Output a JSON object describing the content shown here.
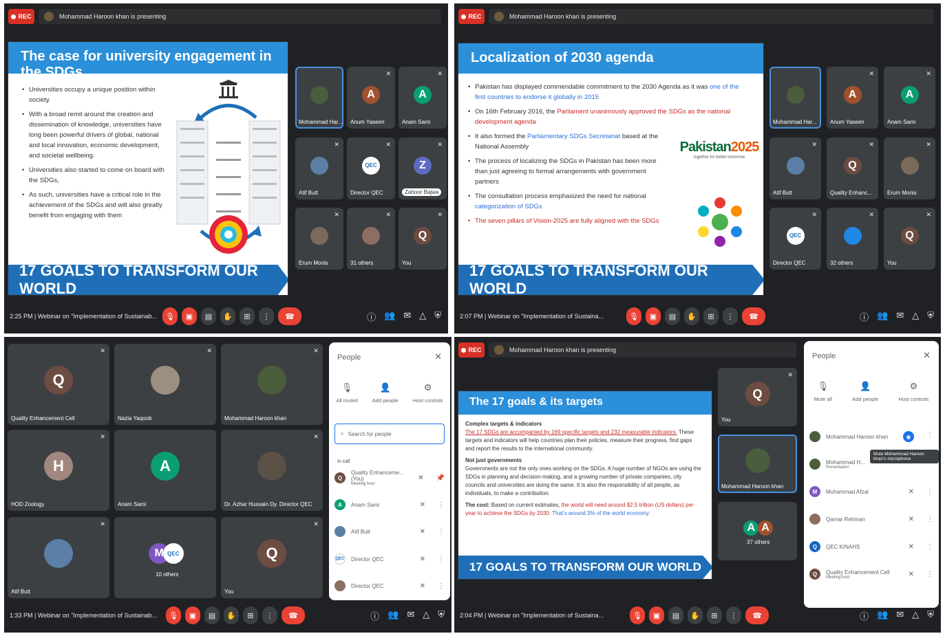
{
  "colors": {
    "meet_bg": "#202124",
    "tile": "#3c4043",
    "accent": "#4a90e2",
    "red": "#ea4335",
    "slide_blue": "#2b8fd9"
  },
  "q1": {
    "rec": "REC",
    "presenting": "Mohammad Haroon khan is presenting",
    "slide_title": "The case for university engagement in the SDGs",
    "bullets": [
      "Universities occupy a unique position within society.",
      "With a broad remit around the creation and dissemination of knowledge, universities have long been powerful drivers of global, national and local innovation, economic development, and societal wellbeing.",
      "Universities also started to come on board with the SDGs,",
      "As such, universities have a critical role in the achievement of the SDGs and will also greatly benefit from engaging with them"
    ],
    "footer": "17 GOALS TO TRANSFORM OUR WORLD",
    "tiles": [
      "Mohammad Har...",
      "Anum Yaseen",
      "Anam Sami",
      "Atif Butt",
      "Director QEC",
      "Zahoor Bajwa",
      "Erum Monis",
      "31 others",
      "You"
    ],
    "time": "2:25 PM",
    "meeting": "Webinar on \"Implementation of Sustainab..."
  },
  "q2": {
    "rec": "REC",
    "presenting": "Mohammad Haroon khan is presenting",
    "slide_title": "Localization of 2030 agenda",
    "b1": "Pakistan has displayed commendable commitment to the 2030 Agenda as it was ",
    "b1h": "one of the first countries to endorse it globally in 2015",
    "b2": "On 16th February 2016, the ",
    "b2h": "Parliament unanimously approved the SDGs as the national development agenda",
    "b3": "It also formed the ",
    "b3h": "Parliamentary SDGs Secretariat",
    " b3e": "",
    "b3t": " based at the National Assembly",
    "b4": "The process of localizing the SDGs in Pakistan has been more than just agreeing to formal arrangements with government partners",
    "b5": "The consultation process emphasized the need for national ",
    "b5h": "categorization of SDGs",
    "b6": "The seven pillars of Vision-2025 are fully aligned with the SDGs",
    "logo": "Pakistan2025",
    "logo_tag": "together for better tomorrow",
    "footer": "17 GOALS TO TRANSFORM OUR WORLD",
    "tiles": [
      "Mohammad Har...",
      "Anum Yaseen",
      "Anam Sami",
      "Atif Butt",
      "Quality Enhanc...",
      "Erum Monis",
      "Director QEC",
      "32 others",
      "You"
    ],
    "time": "2:07 PM",
    "meeting": "Webinar on \"Implementation of Sustaina..."
  },
  "q3": {
    "tiles": [
      "Quality Enhancement Cell",
      "Nazia Yaqoob",
      "Mohammad Haroon khan",
      "HOD Zoology",
      "Anam Sami",
      "Dr. Azhar Hussain Dy. Director QEC",
      "Atif Butt",
      "10 others",
      "You"
    ],
    "people": {
      "title": "People",
      "actions": [
        "All muted",
        "Add people",
        "Host controls"
      ],
      "search": "Search for people",
      "in_call": "In call",
      "rows": [
        {
          "n": "Quality Enhanceme... (You)",
          "s": "Meeting host"
        },
        {
          "n": "Anam Sami"
        },
        {
          "n": "Atif Butt"
        },
        {
          "n": "Director QEC"
        },
        {
          "n": "Director QEC"
        }
      ]
    },
    "time": "1:33 PM",
    "meeting": "Webinar on \"Implementation of Sustainab..."
  },
  "q4": {
    "rec": "REC",
    "presenting": "Mohammad Haroon khan is presenting",
    "slide_title": "The 17 goals & its targets",
    "h1": "Complex targets & indicators",
    "p1a": "The 17 SDGs are accompanied by 169 specific targets and 232 measurable indicators.",
    "p1b": " These targets and indicators will help countries plan their policies, measure their progress, find gaps and report the results to the international community.",
    "h2": "Not just governments",
    "p2": "Governments are not the only ones working on the SDGs. A huge number of NGOs are using the SDGs in planning and decision-making, and a growing number of private companies, city councils and universities are doing the same. It is also the responsibility of all people, as individuals, to make a contribution.",
    "h3": "The cost:",
    "p3a": " Based on current estimates, ",
    "p3b": "the world will need around $2.5 trillion (US dollars) per year to achieve the SDGs by 2030.",
    "p3c": " That's around 3% of the world economy.",
    "footer": "17 GOALS TO TRANSFORM OUR WORLD",
    "tiles": [
      "You",
      "Mohammad Haroon khan",
      "37 others"
    ],
    "people": {
      "title": "People",
      "actions": [
        "Mute all",
        "Add people",
        "Host controls"
      ],
      "rows": [
        {
          "n": "Mohammad Haroon khan"
        },
        {
          "n": "Mohammad H...",
          "s": "Presentation"
        },
        {
          "n": "Muhammad Afzal"
        },
        {
          "n": "Qamar Rehman"
        },
        {
          "n": "QEC KINAHS"
        },
        {
          "n": "Quality Enhancement Cell",
          "s": "Meeting host"
        }
      ],
      "tooltip": "Mute Mohammad Haroon khan's microphone"
    },
    "time": "2:04 PM",
    "meeting": "Webinar on \"Implementation of Sustaina..."
  }
}
